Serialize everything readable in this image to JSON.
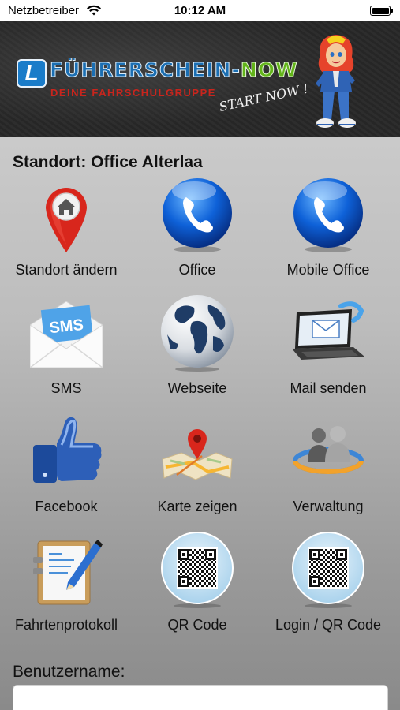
{
  "status_bar": {
    "carrier": "Netzbetreiber",
    "time": "10:12 AM"
  },
  "banner": {
    "brand_main": "FÜHRERSCHEIN-",
    "brand_accent": "NOW",
    "tagline": "DEINE FAHRSCHULGRUPPE",
    "slogan": "START NOW !",
    "logo_letter": "L",
    "colors": {
      "brand_blue": "#1b6fb3",
      "brand_green": "#63b51a",
      "tagline_red": "#c8251d"
    }
  },
  "location": {
    "title": "Standort: Office Alterlaa"
  },
  "tiles": [
    {
      "label": "Standort ändern",
      "icon": "map-pin-home-icon"
    },
    {
      "label": "Office",
      "icon": "phone-icon"
    },
    {
      "label": "Mobile Office",
      "icon": "phone-icon"
    },
    {
      "label": "SMS",
      "icon": "sms-envelope-icon"
    },
    {
      "label": "Webseite",
      "icon": "globe-icon"
    },
    {
      "label": "Mail senden",
      "icon": "laptop-mail-icon"
    },
    {
      "label": "Facebook",
      "icon": "thumbs-up-icon"
    },
    {
      "label": "Karte zeigen",
      "icon": "map-icon"
    },
    {
      "label": "Verwaltung",
      "icon": "users-icon"
    },
    {
      "label": "Fahrtenprotokoll",
      "icon": "clipboard-pen-icon"
    },
    {
      "label": "QR Code",
      "icon": "qr-code-icon"
    },
    {
      "label": "Login / QR Code",
      "icon": "qr-code-icon"
    }
  ],
  "login": {
    "username_label": "Benutzername:",
    "username_value": ""
  }
}
